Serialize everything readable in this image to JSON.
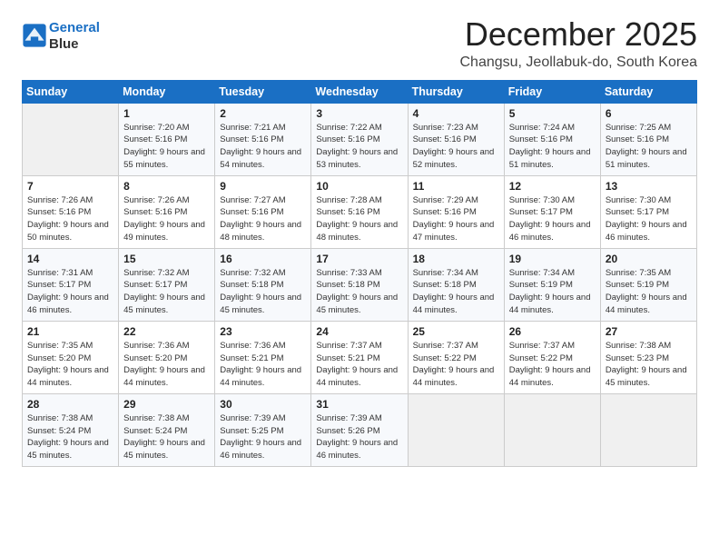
{
  "logo": {
    "line1": "General",
    "line2": "Blue"
  },
  "title": "December 2025",
  "location": "Changsu, Jeollabuk-do, South Korea",
  "days_of_week": [
    "Sunday",
    "Monday",
    "Tuesday",
    "Wednesday",
    "Thursday",
    "Friday",
    "Saturday"
  ],
  "weeks": [
    [
      {
        "day": "",
        "info": ""
      },
      {
        "day": "1",
        "info": "Sunrise: 7:20 AM\nSunset: 5:16 PM\nDaylight: 9 hours\nand 55 minutes."
      },
      {
        "day": "2",
        "info": "Sunrise: 7:21 AM\nSunset: 5:16 PM\nDaylight: 9 hours\nand 54 minutes."
      },
      {
        "day": "3",
        "info": "Sunrise: 7:22 AM\nSunset: 5:16 PM\nDaylight: 9 hours\nand 53 minutes."
      },
      {
        "day": "4",
        "info": "Sunrise: 7:23 AM\nSunset: 5:16 PM\nDaylight: 9 hours\nand 52 minutes."
      },
      {
        "day": "5",
        "info": "Sunrise: 7:24 AM\nSunset: 5:16 PM\nDaylight: 9 hours\nand 51 minutes."
      },
      {
        "day": "6",
        "info": "Sunrise: 7:25 AM\nSunset: 5:16 PM\nDaylight: 9 hours\nand 51 minutes."
      }
    ],
    [
      {
        "day": "7",
        "info": "Sunrise: 7:26 AM\nSunset: 5:16 PM\nDaylight: 9 hours\nand 50 minutes."
      },
      {
        "day": "8",
        "info": "Sunrise: 7:26 AM\nSunset: 5:16 PM\nDaylight: 9 hours\nand 49 minutes."
      },
      {
        "day": "9",
        "info": "Sunrise: 7:27 AM\nSunset: 5:16 PM\nDaylight: 9 hours\nand 48 minutes."
      },
      {
        "day": "10",
        "info": "Sunrise: 7:28 AM\nSunset: 5:16 PM\nDaylight: 9 hours\nand 48 minutes."
      },
      {
        "day": "11",
        "info": "Sunrise: 7:29 AM\nSunset: 5:16 PM\nDaylight: 9 hours\nand 47 minutes."
      },
      {
        "day": "12",
        "info": "Sunrise: 7:30 AM\nSunset: 5:17 PM\nDaylight: 9 hours\nand 46 minutes."
      },
      {
        "day": "13",
        "info": "Sunrise: 7:30 AM\nSunset: 5:17 PM\nDaylight: 9 hours\nand 46 minutes."
      }
    ],
    [
      {
        "day": "14",
        "info": "Sunrise: 7:31 AM\nSunset: 5:17 PM\nDaylight: 9 hours\nand 46 minutes."
      },
      {
        "day": "15",
        "info": "Sunrise: 7:32 AM\nSunset: 5:17 PM\nDaylight: 9 hours\nand 45 minutes."
      },
      {
        "day": "16",
        "info": "Sunrise: 7:32 AM\nSunset: 5:18 PM\nDaylight: 9 hours\nand 45 minutes."
      },
      {
        "day": "17",
        "info": "Sunrise: 7:33 AM\nSunset: 5:18 PM\nDaylight: 9 hours\nand 45 minutes."
      },
      {
        "day": "18",
        "info": "Sunrise: 7:34 AM\nSunset: 5:18 PM\nDaylight: 9 hours\nand 44 minutes."
      },
      {
        "day": "19",
        "info": "Sunrise: 7:34 AM\nSunset: 5:19 PM\nDaylight: 9 hours\nand 44 minutes."
      },
      {
        "day": "20",
        "info": "Sunrise: 7:35 AM\nSunset: 5:19 PM\nDaylight: 9 hours\nand 44 minutes."
      }
    ],
    [
      {
        "day": "21",
        "info": "Sunrise: 7:35 AM\nSunset: 5:20 PM\nDaylight: 9 hours\nand 44 minutes."
      },
      {
        "day": "22",
        "info": "Sunrise: 7:36 AM\nSunset: 5:20 PM\nDaylight: 9 hours\nand 44 minutes."
      },
      {
        "day": "23",
        "info": "Sunrise: 7:36 AM\nSunset: 5:21 PM\nDaylight: 9 hours\nand 44 minutes."
      },
      {
        "day": "24",
        "info": "Sunrise: 7:37 AM\nSunset: 5:21 PM\nDaylight: 9 hours\nand 44 minutes."
      },
      {
        "day": "25",
        "info": "Sunrise: 7:37 AM\nSunset: 5:22 PM\nDaylight: 9 hours\nand 44 minutes."
      },
      {
        "day": "26",
        "info": "Sunrise: 7:37 AM\nSunset: 5:22 PM\nDaylight: 9 hours\nand 44 minutes."
      },
      {
        "day": "27",
        "info": "Sunrise: 7:38 AM\nSunset: 5:23 PM\nDaylight: 9 hours\nand 45 minutes."
      }
    ],
    [
      {
        "day": "28",
        "info": "Sunrise: 7:38 AM\nSunset: 5:24 PM\nDaylight: 9 hours\nand 45 minutes."
      },
      {
        "day": "29",
        "info": "Sunrise: 7:38 AM\nSunset: 5:24 PM\nDaylight: 9 hours\nand 45 minutes."
      },
      {
        "day": "30",
        "info": "Sunrise: 7:39 AM\nSunset: 5:25 PM\nDaylight: 9 hours\nand 46 minutes."
      },
      {
        "day": "31",
        "info": "Sunrise: 7:39 AM\nSunset: 5:26 PM\nDaylight: 9 hours\nand 46 minutes."
      },
      {
        "day": "",
        "info": ""
      },
      {
        "day": "",
        "info": ""
      },
      {
        "day": "",
        "info": ""
      }
    ]
  ]
}
